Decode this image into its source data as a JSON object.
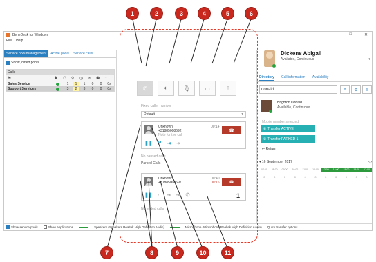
{
  "window": {
    "title": "BeneDesk for Windows",
    "controls": [
      "–",
      "□",
      "✕"
    ],
    "menu": [
      "File",
      "Help"
    ]
  },
  "left_panel": {
    "tabs": [
      "Service pool management",
      "Active pools",
      "Service calls"
    ],
    "show_joined_pools": "Show joined pools",
    "calls_header": "Calls",
    "icons": [
      "pool-icon",
      "lock-icon",
      "users-icon",
      "bulb-icon",
      "clock-icon",
      "chat-icon",
      "group-icon",
      "timer-icon"
    ],
    "pools": [
      {
        "name": "Sales Service",
        "values": [
          "1",
          "1",
          "1",
          "0",
          "0",
          "0s"
        ]
      },
      {
        "name": "Support Services",
        "values": [
          "3",
          "2",
          "3",
          "0",
          "0",
          "0s"
        ]
      }
    ],
    "bottom": {
      "show_service_pools": "Show service pools",
      "show_applications": "Show applications",
      "speakers": "Speakers (Speakers Realtek High Definition Audio)",
      "microphone": "Microphone (Microphone Realtek High Definition Audio)",
      "quick_transfer": "Quick transfer options"
    }
  },
  "middle_panel": {
    "fixed_caller_label": "Fixed caller number",
    "default_option": "Default",
    "active_call": {
      "name": "Unknown",
      "number": "+31885008692",
      "note": "Note for the call",
      "duration": "00:14"
    },
    "no_paused": "No paused calls",
    "parked_label": "Parked Calls",
    "parked_call": {
      "name": "Unknown",
      "number": "+31885008697",
      "duration": "00:40",
      "parked_time": "00:16",
      "count": "1"
    },
    "no_ended": "No ended calls"
  },
  "right_panel": {
    "name": "Dickens Abigail",
    "status": "Available, Continuous",
    "tabs": [
      "Directory",
      "Call information",
      "Availability"
    ],
    "search_value": "donald",
    "contact": {
      "name": "Brighton Donald",
      "status": "Available, Continuous"
    },
    "mobile_selected": "Mobile number selected",
    "transfer_active": "Transfer ACTIVE",
    "transfer_parked": "Transfer PARKED 1",
    "return": "Return",
    "date": "16 September 2017",
    "timeline_hours": [
      "07:00",
      "08:00",
      "09:00",
      "10:00",
      "11:00",
      "12:00",
      "13:00",
      "14:00",
      "15:00",
      "16:00",
      "17:00"
    ],
    "timeline_busy": [
      false,
      false,
      false,
      false,
      false,
      false,
      true,
      true,
      true,
      true,
      true
    ],
    "timeline_values": [
      "0",
      "0",
      "0",
      "0",
      "0",
      "0",
      "0",
      "0",
      "0",
      "0",
      "0"
    ]
  },
  "callouts": [
    "1",
    "2",
    "3",
    "4",
    "5",
    "6",
    "7",
    "8",
    "9",
    "10",
    "11"
  ],
  "colors": {
    "accent": "#2a7fc0",
    "callout": "#c8281e",
    "hangup": "#b63a2a",
    "transfer": "#27b0b3",
    "available": "#23a33c"
  }
}
